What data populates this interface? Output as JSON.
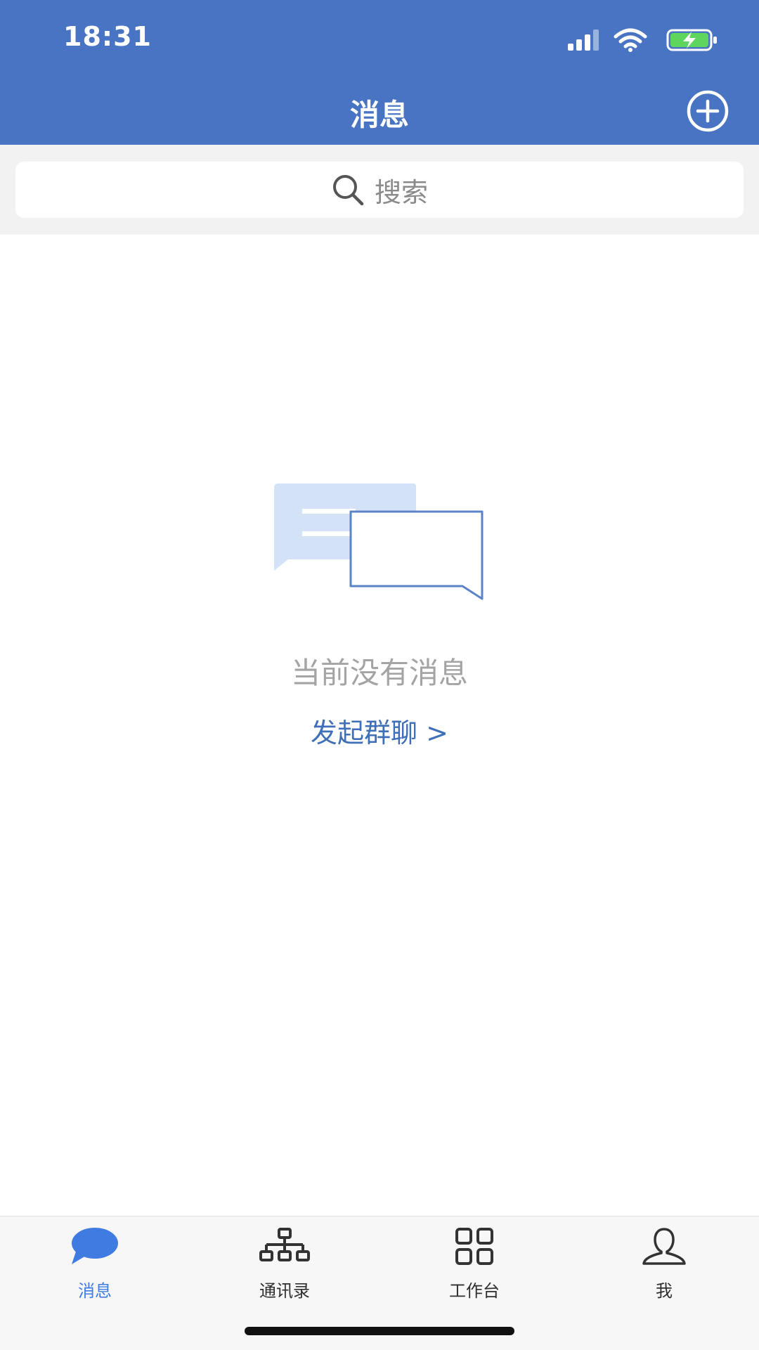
{
  "status_bar": {
    "time": "18:31"
  },
  "header": {
    "title": "消息"
  },
  "search": {
    "placeholder": "搜索"
  },
  "empty_state": {
    "message": "当前没有消息",
    "action_label": "发起群聊 >"
  },
  "tabbar": {
    "items": [
      {
        "label": "消息",
        "icon": "chat-bubble-icon",
        "active": true
      },
      {
        "label": "通讯录",
        "icon": "org-chart-icon",
        "active": false
      },
      {
        "label": "工作台",
        "icon": "grid-icon",
        "active": false
      },
      {
        "label": "我",
        "icon": "user-icon",
        "active": false
      }
    ]
  },
  "colors": {
    "header_bg": "#4874c3",
    "accent": "#3f7be0",
    "link": "#3f6fb8",
    "muted_text": "#a4a4a4"
  }
}
